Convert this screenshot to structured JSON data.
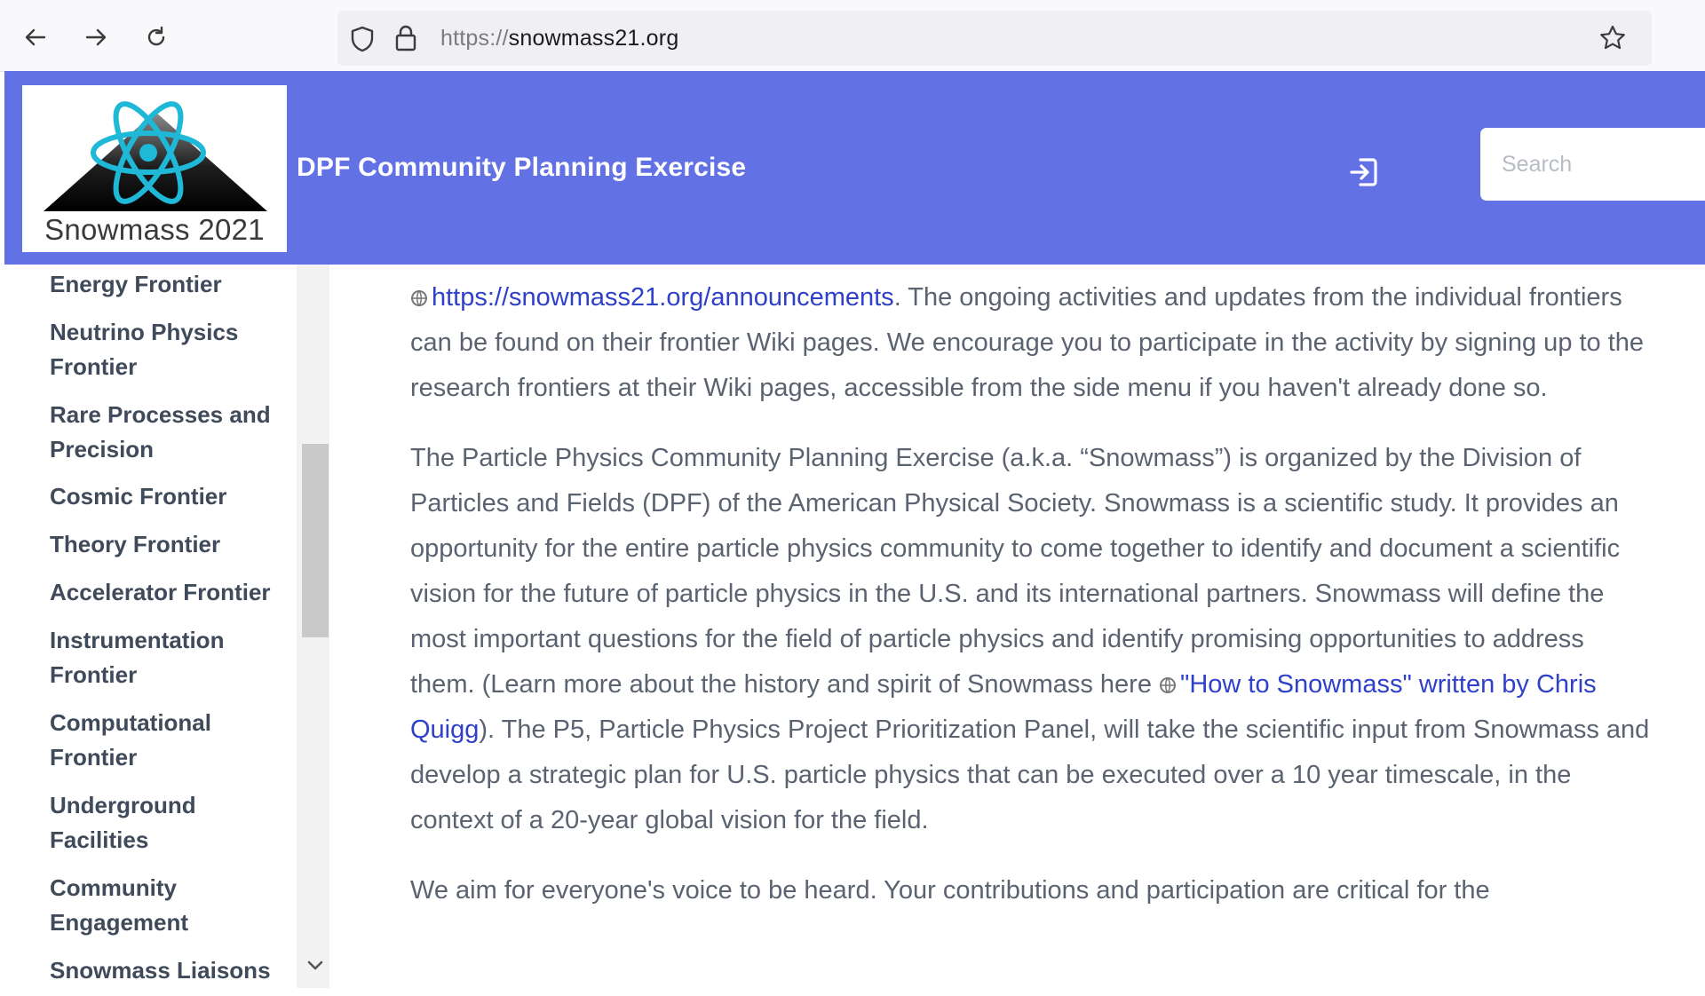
{
  "browser": {
    "url_scheme": "https://",
    "url_host": "snowmass21.org"
  },
  "header": {
    "logo_caption": "Snowmass 2021",
    "title": "DPF Community Planning Exercise",
    "search_placeholder": "Search"
  },
  "sidebar": {
    "items": [
      "Energy Frontier",
      "Neutrino Physics Frontier",
      "Rare Processes and Precision",
      "Cosmic Frontier",
      "Theory Frontier",
      "Accelerator Frontier",
      "Instrumentation Frontier",
      "Computational Frontier",
      "Underground Facilities",
      "Community Engagement",
      "Snowmass Liaisons"
    ]
  },
  "content": {
    "p1_link": "https://snowmass21.org/announcements",
    "p1_text": ". The ongoing activities and updates from the individual frontiers can be found on their frontier Wiki pages. We encourage you to participate in the activity by signing up to the research frontiers at their Wiki pages, accessible from the side menu if you haven't already done so.",
    "p2_text_a": "The Particle Physics Community Planning Exercise (a.k.a. “Snowmass”) is organized by the Division of Particles and Fields (DPF) of the American Physical Society. Snowmass is a scientific study. It provides an opportunity for the entire particle physics community to come together to identify and document a scientific vision for the future of particle physics in the U.S. and its international partners. Snowmass will define the most important questions for the field of particle physics and identify promising opportunities to address them. (Learn more about the history and spirit of Snowmass here ",
    "p2_link": "\"How to Snowmass\" written by Chris Quigg",
    "p2_text_b": "). The P5, Particle Physics Project Prioritization Panel, will take the scientific input from Snowmass and develop a strategic plan for U.S. particle physics that can be executed over a 10 year timescale, in the context of a 20-year global vision for the field.",
    "p3_text": "We aim for everyone's voice to be heard. Your contributions and participation are critical for the"
  },
  "colors": {
    "header_bg": "#6272e4",
    "link": "#2f40c9",
    "body_text": "#5b6270",
    "sidebar_text": "#3f4a5a"
  },
  "icons": [
    "back-arrow-icon",
    "forward-arrow-icon",
    "reload-icon",
    "shield-icon",
    "lock-icon",
    "star-icon",
    "login-icon",
    "globe-icon",
    "chevron-down-icon"
  ]
}
